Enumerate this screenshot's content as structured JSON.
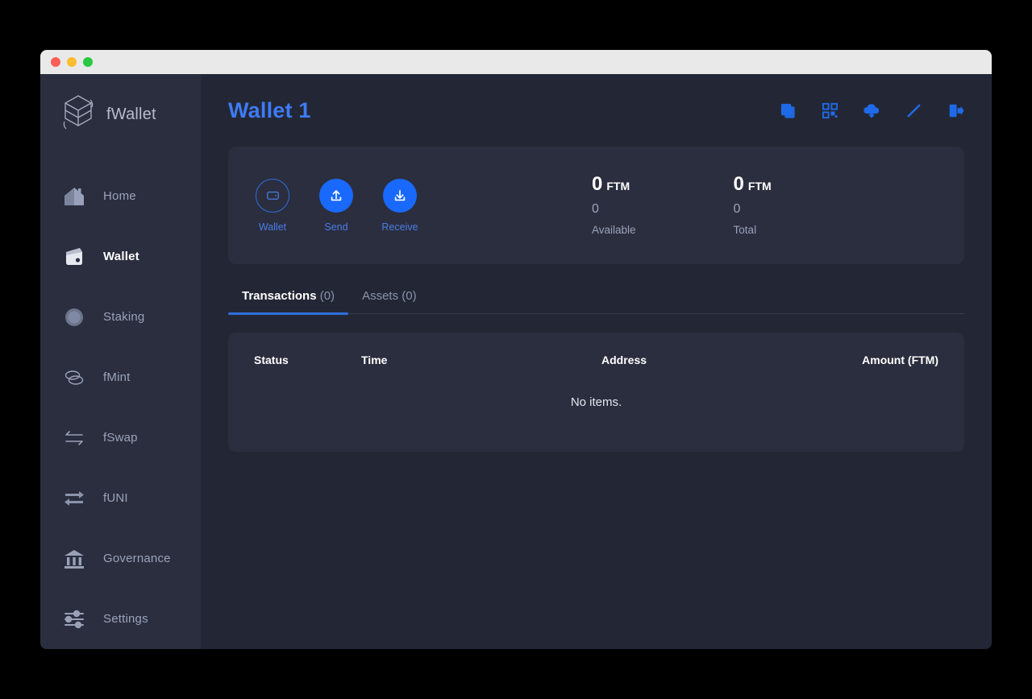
{
  "window": {
    "traffic_lights": [
      "close",
      "minimize",
      "maximize"
    ],
    "chrome_color": "#e9e9e9"
  },
  "sidebar": {
    "brand": {
      "name": "fWallet",
      "logo_icon": "fantom-logo-icon"
    },
    "items": [
      {
        "label": "Home",
        "icon": "home-icon",
        "active": false
      },
      {
        "label": "Wallet",
        "icon": "wallet-icon",
        "active": true
      },
      {
        "label": "Staking",
        "icon": "staking-icon",
        "active": false
      },
      {
        "label": "fMint",
        "icon": "coins-icon",
        "active": false
      },
      {
        "label": "fSwap",
        "icon": "swap-icon",
        "active": false
      },
      {
        "label": "fUNI",
        "icon": "arrows-icon",
        "active": false
      },
      {
        "label": "Governance",
        "icon": "bank-icon",
        "active": false
      },
      {
        "label": "Settings",
        "icon": "sliders-icon",
        "active": false
      }
    ]
  },
  "header": {
    "title": "Wallet 1",
    "title_color": "#3e7bf5",
    "icons": [
      {
        "name": "copy-icon"
      },
      {
        "name": "qr-code-icon"
      },
      {
        "name": "cloud-download-icon"
      },
      {
        "name": "edit-pencil-icon"
      },
      {
        "name": "logout-icon"
      }
    ]
  },
  "balance_card": {
    "actions": [
      {
        "label": "Wallet",
        "icon": "wallet-outline-icon",
        "style": "outline"
      },
      {
        "label": "Send",
        "icon": "upload-arrow-icon",
        "style": "solid"
      },
      {
        "label": "Receive",
        "icon": "download-arrow-icon",
        "style": "solid"
      }
    ],
    "available": {
      "amount": "0",
      "unit": "FTM",
      "sub": "0",
      "label": "Available"
    },
    "total": {
      "amount": "0",
      "unit": "FTM",
      "sub": "0",
      "label": "Total"
    },
    "accent_color": "#1969ff"
  },
  "tabs": [
    {
      "name": "Transactions",
      "count": "(0)",
      "active": true
    },
    {
      "name": "Assets",
      "count": "(0)",
      "active": false
    }
  ],
  "table": {
    "columns": [
      "Status",
      "Time",
      "Address",
      "Amount (FTM)"
    ],
    "rows": [],
    "empty_text": "No items."
  }
}
